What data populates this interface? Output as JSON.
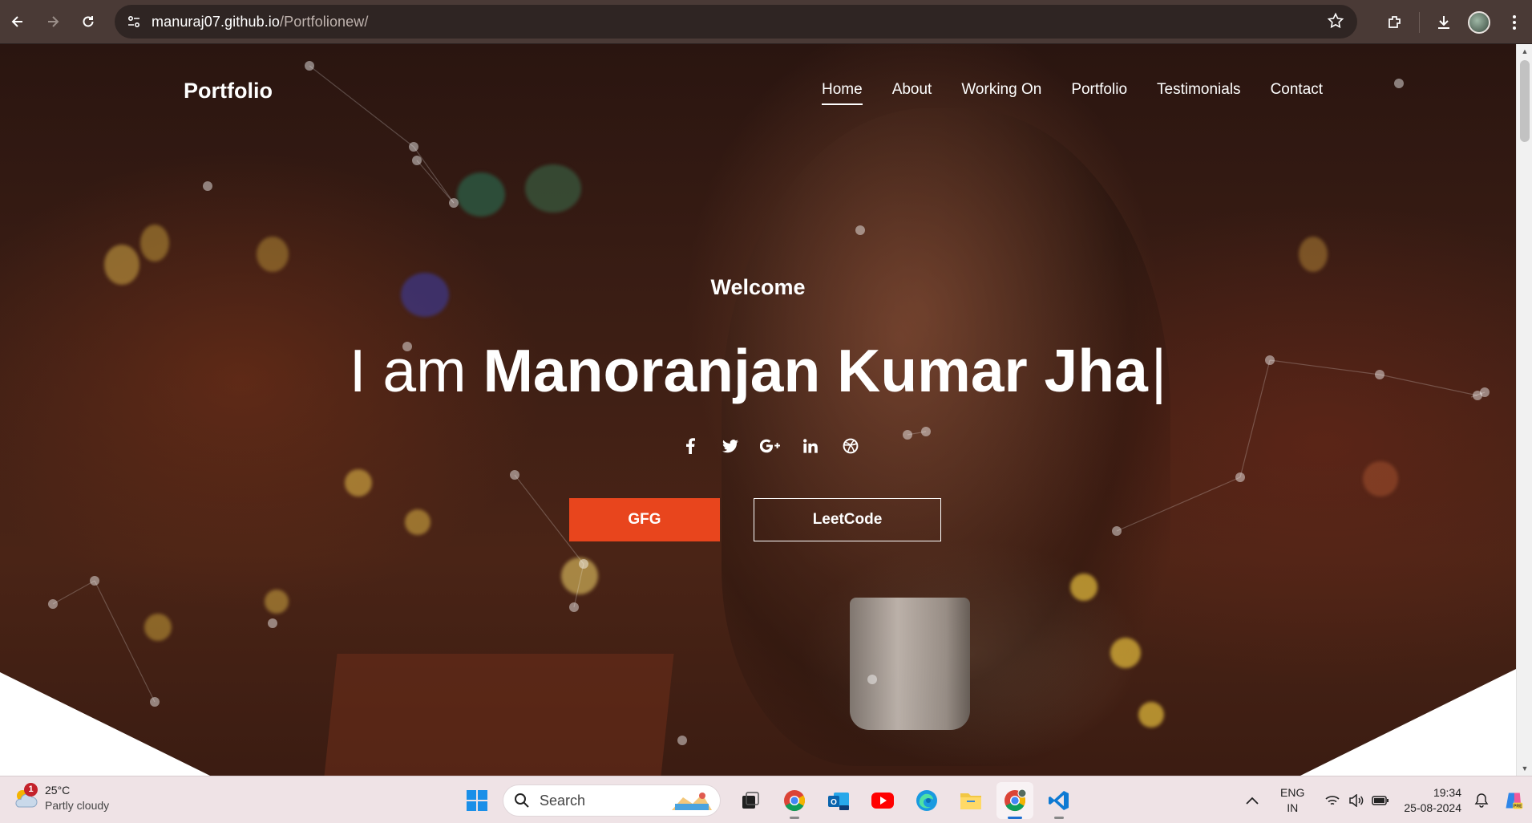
{
  "browser": {
    "url_host": "manuraj07.github.io",
    "url_path": "/Portfolionew/"
  },
  "site": {
    "brand": "Portfolio",
    "nav": [
      {
        "label": "Home",
        "active": true
      },
      {
        "label": "About"
      },
      {
        "label": "Working On"
      },
      {
        "label": "Portfolio"
      },
      {
        "label": "Testimonials"
      },
      {
        "label": "Contact"
      }
    ],
    "hero": {
      "welcome": "Welcome",
      "prefix": "I am",
      "name": "Manoranjan Kumar Jha",
      "cursor": "|"
    },
    "socials": [
      {
        "icon": "facebook-icon",
        "glyph": "f"
      },
      {
        "icon": "twitter-icon",
        "glyph": "🐦"
      },
      {
        "icon": "google-plus-icon",
        "glyph": "G+"
      },
      {
        "icon": "linkedin-icon",
        "glyph": "in"
      },
      {
        "icon": "dribbble-icon",
        "glyph": "⊛"
      }
    ],
    "buttons": {
      "primary": "GFG",
      "secondary": "LeetCode"
    },
    "accent_color": "#e8451d"
  },
  "taskbar": {
    "weather": {
      "badge": "1",
      "temp": "25°C",
      "condition": "Partly cloudy"
    },
    "search_label": "Search",
    "lang_top": "ENG",
    "lang_bottom": "IN",
    "time": "19:34",
    "date": "25-08-2024"
  }
}
